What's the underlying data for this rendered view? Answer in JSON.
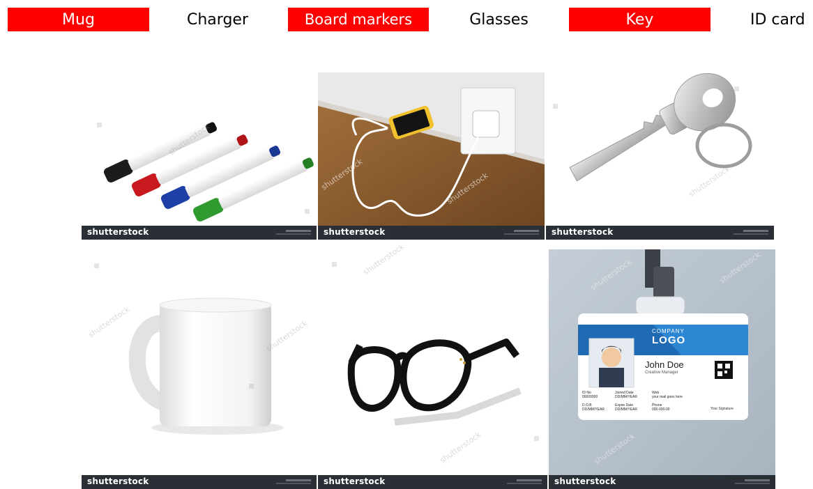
{
  "labels": [
    {
      "text": "Mug",
      "highlight": true
    },
    {
      "text": "Charger",
      "highlight": false
    },
    {
      "text": "Board markers",
      "highlight": true
    },
    {
      "text": "Glasses",
      "highlight": false
    },
    {
      "text": "Key",
      "highlight": true
    },
    {
      "text": "ID card",
      "highlight": false
    }
  ],
  "colors": {
    "highlight": "#ff0000",
    "brand_bar": "#2a2e35"
  },
  "tiles": [
    {
      "subject": "board markers",
      "brand": "shutterstock"
    },
    {
      "subject": "phone charging",
      "brand": "shutterstock"
    },
    {
      "subject": "key",
      "brand": "shutterstock"
    },
    {
      "subject": "white mug",
      "brand": "shutterstock"
    },
    {
      "subject": "black glasses",
      "brand": "shutterstock"
    },
    {
      "subject": "id card",
      "brand": "shutterstock"
    }
  ],
  "watermark": "shutterstock",
  "idcard": {
    "company": "COMPANY",
    "logo": "LOGO",
    "name": "John Doe",
    "role": "Creative Manager",
    "id_label": "ID No",
    "id_value": "00000000",
    "joined_label": "Joined Date",
    "joined_value": "DD/MM/YEAR",
    "web_label": "Web",
    "web_value": "your mail goes here",
    "dob_label": "D.O.B",
    "dob_value": "DD/MM/YEAR",
    "expire_label": "Expire Date",
    "expire_value": "DD/MM/YEAR",
    "phone_label": "Phone",
    "phone_value": "000-000-00",
    "signature": "Your Signature"
  }
}
